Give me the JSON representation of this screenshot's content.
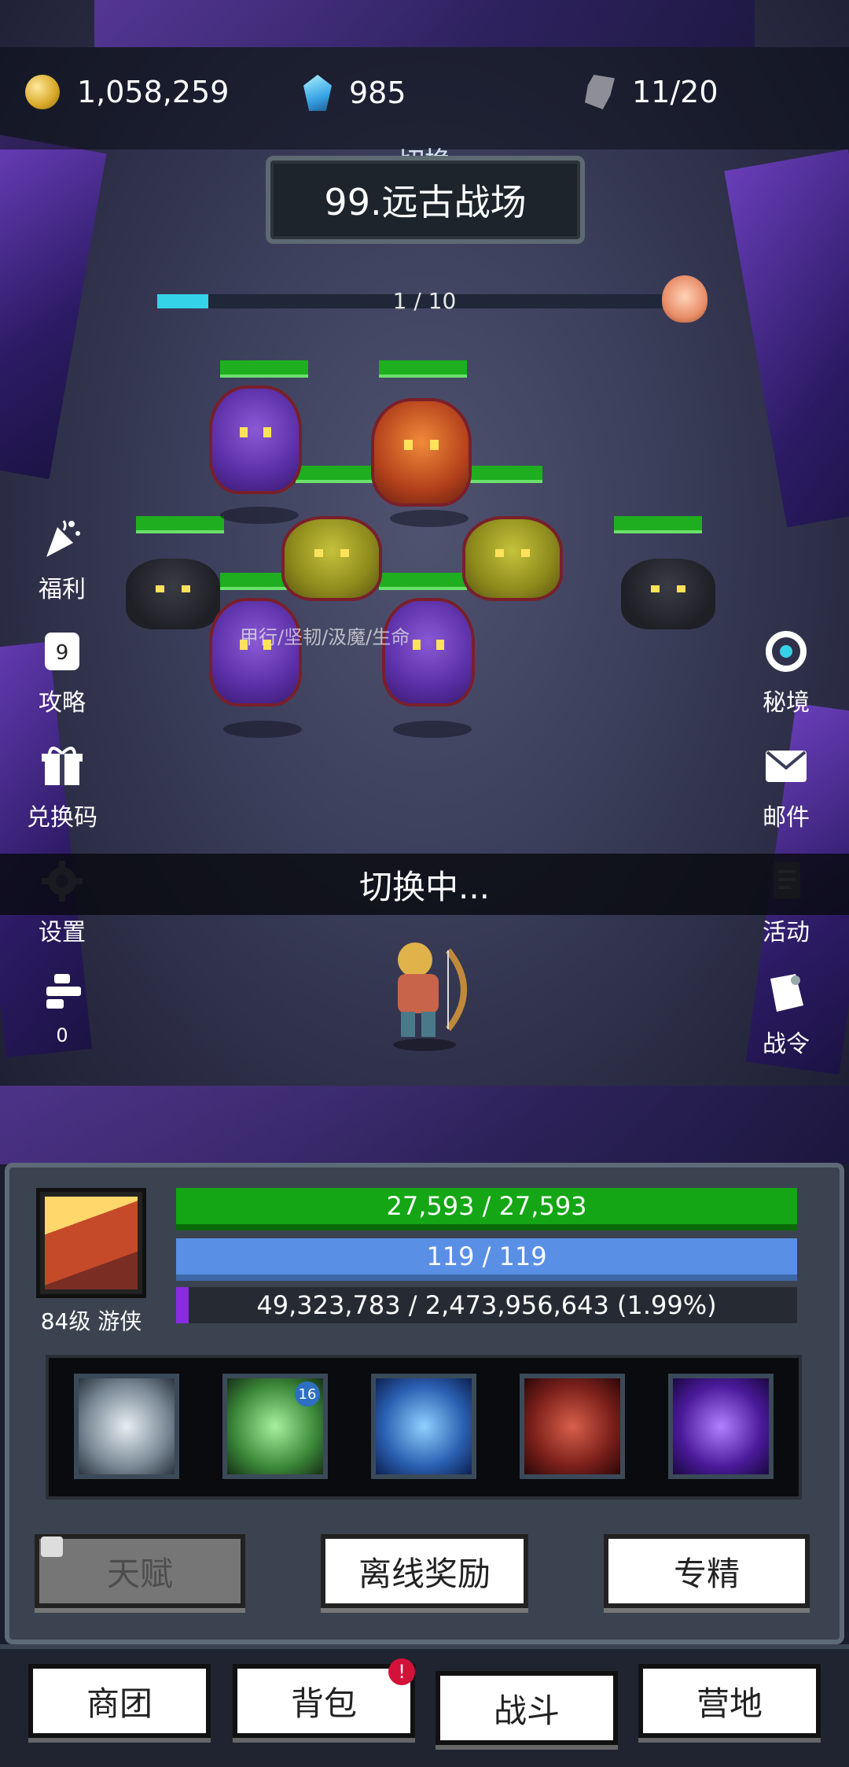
{
  "resources": {
    "gold": "1,058,259",
    "diamonds": "985",
    "stamina": "11/20"
  },
  "stage": {
    "switch_label": "切换",
    "name": "99.远古战场"
  },
  "wave": {
    "text": "1 / 10",
    "progress": 0.1
  },
  "battle": {
    "affix_text": "甲行/坚韧/汲魔/生命",
    "status_text": "切换中..."
  },
  "left_menu": [
    {
      "label": "福利"
    },
    {
      "label": "攻略"
    },
    {
      "label": "兑换码"
    },
    {
      "label": "设置"
    },
    {
      "label": "0"
    }
  ],
  "right_menu": [
    {
      "label": "秘境"
    },
    {
      "label": "邮件"
    },
    {
      "label": "活动"
    },
    {
      "label": "战令"
    }
  ],
  "player": {
    "level_class": "84级  游侠",
    "hp_text": "27,593  /  27,593",
    "mp_text": "119  /  119",
    "xp_text": "49,323,783  /  2,473,956,643 (1.99%)",
    "xp_progress": 0.0199
  },
  "skills": [
    {
      "name": "whirlwind-blade-skill"
    },
    {
      "name": "multi-arrow-skill",
      "badge": "16"
    },
    {
      "name": "spirit-form-skill"
    },
    {
      "name": "crossbow-skill"
    },
    {
      "name": "shadow-blade-skill"
    }
  ],
  "actions": {
    "talent": "天赋",
    "offline_reward": "离线奖励",
    "specialization": "专精"
  },
  "nav": {
    "guild": "商团",
    "bag": "背包",
    "bag_alert": "!",
    "battle": "战斗",
    "camp": "营地"
  },
  "colors": {
    "hp": "#14a614",
    "mp": "#5a8fe6",
    "xp": "#8a2be2",
    "wave": "#35d3e8"
  }
}
